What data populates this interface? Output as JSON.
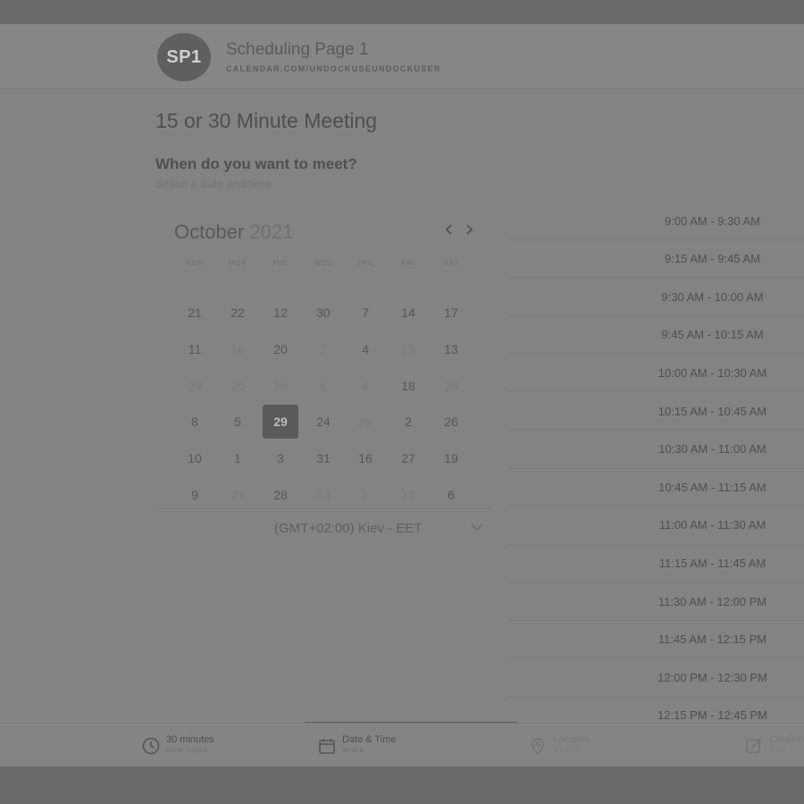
{
  "header": {
    "avatar_initials": "SP1",
    "title": "Scheduling Page 1",
    "url": "CALENDAR.COM/UNDOCKUSEUNDOCKUSER"
  },
  "meeting": {
    "title": "15 or 30 Minute Meeting",
    "question": "When do you want to meet?",
    "hint": "Select a date and time"
  },
  "calendar": {
    "month": "October",
    "year": "2021",
    "prev_icon": "chevron-left-icon",
    "next_icon": "chevron-right-icon",
    "weekdays": [
      "SUN",
      "MON",
      "TUE",
      "WED",
      "THU",
      "FRI",
      "SAT"
    ],
    "weeks": [
      [
        {
          "d": "21",
          "a": true
        },
        {
          "d": "22",
          "a": true
        },
        {
          "d": "12",
          "a": true
        },
        {
          "d": "30",
          "a": true
        },
        {
          "d": "7",
          "a": true
        },
        {
          "d": "14",
          "a": true
        },
        {
          "d": "17",
          "a": true
        }
      ],
      [
        {
          "d": "11",
          "a": true
        },
        {
          "d": "18",
          "a": false
        },
        {
          "d": "20",
          "a": true
        },
        {
          "d": "7",
          "a": false
        },
        {
          "d": "4",
          "a": true
        },
        {
          "d": "13",
          "a": false
        },
        {
          "d": "13",
          "a": true
        }
      ],
      [
        {
          "d": "23",
          "a": false
        },
        {
          "d": "25",
          "a": false
        },
        {
          "d": "20",
          "a": false
        },
        {
          "d": "6",
          "a": false
        },
        {
          "d": "4",
          "a": false
        },
        {
          "d": "18",
          "a": true
        },
        {
          "d": "26",
          "a": false
        }
      ],
      [
        {
          "d": "8",
          "a": true
        },
        {
          "d": "5",
          "a": true
        },
        {
          "d": "29",
          "a": true,
          "selected": true
        },
        {
          "d": "24",
          "a": true
        },
        {
          "d": "29",
          "a": false
        },
        {
          "d": "2",
          "a": true
        },
        {
          "d": "26",
          "a": true
        }
      ],
      [
        {
          "d": "10",
          "a": true
        },
        {
          "d": "1",
          "a": true
        },
        {
          "d": "3",
          "a": true
        },
        {
          "d": "31",
          "a": true
        },
        {
          "d": "16",
          "a": true
        },
        {
          "d": "27",
          "a": true
        },
        {
          "d": "19",
          "a": true
        }
      ],
      [
        {
          "d": "9",
          "a": true
        },
        {
          "d": "27",
          "a": false
        },
        {
          "d": "28",
          "a": true
        },
        {
          "d": "14",
          "a": false
        },
        {
          "d": "1",
          "a": false
        },
        {
          "d": "12",
          "a": false
        },
        {
          "d": "6",
          "a": true
        }
      ]
    ]
  },
  "timezone": {
    "value": "(GMT+02:00) Kiev - EET",
    "icon": "chevron-down-icon"
  },
  "time_slots": [
    "9:00 AM - 9:30 AM",
    "9:15 AM - 9:45 AM",
    "9:30 AM - 10:00 AM",
    "9:45 AM - 10:15 AM",
    "10:00 AM - 10:30 AM",
    "10:15 AM - 10:45 AM",
    "10:30 AM - 11:00 AM",
    "10:45 AM - 11:15 AM",
    "11:00 AM - 11:30 AM",
    "11:15 AM - 11:45 AM",
    "11:30 AM - 12:00 PM",
    "11:45 AM - 12:15 PM",
    "12:00 PM - 12:30 PM",
    "12:15 PM - 12:45 PM"
  ],
  "steps": {
    "duration": {
      "label": "30 minutes",
      "sub": "HOW LONG",
      "icon": "clock-icon"
    },
    "datetime": {
      "label": "Date & Time",
      "sub": "WHEN",
      "icon": "calendar-icon"
    },
    "location": {
      "label": "Location",
      "sub": "WHERE",
      "icon": "location-pin-icon"
    },
    "confirm": {
      "label": "Confirm",
      "sub": "WHO",
      "icon": "edit-icon"
    }
  }
}
